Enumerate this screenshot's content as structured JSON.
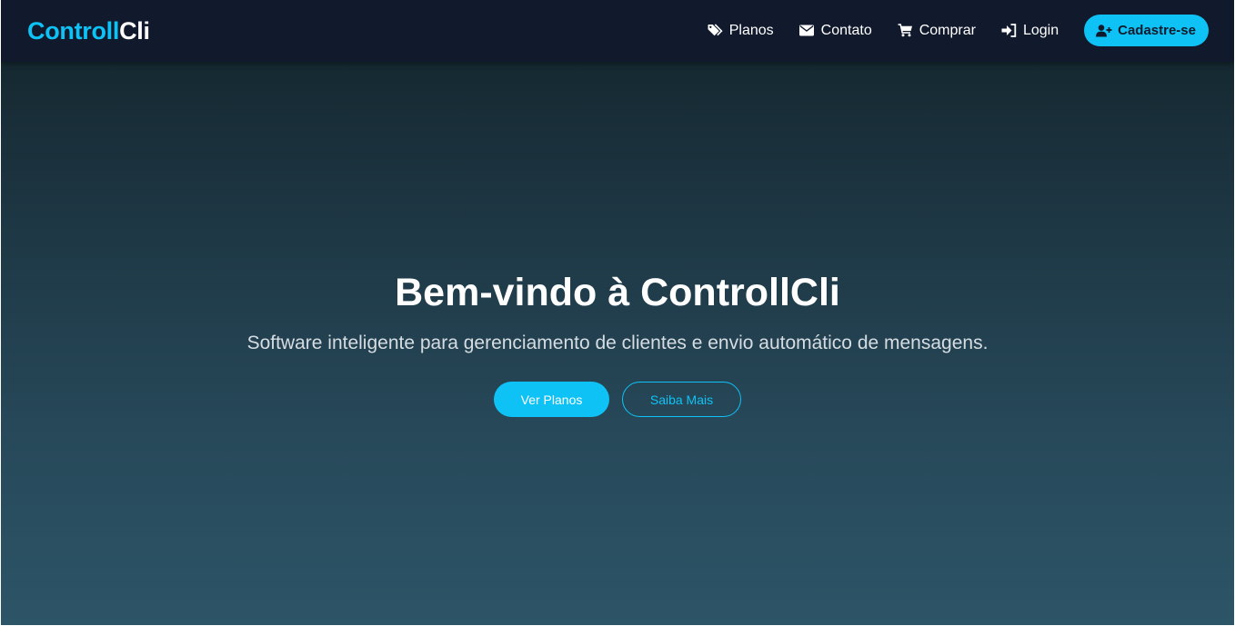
{
  "navbar": {
    "brand": {
      "part1": "Controll",
      "part2": "Cli"
    },
    "links": [
      {
        "label": "Planos",
        "icon": "tags-icon"
      },
      {
        "label": "Contato",
        "icon": "envelope-icon"
      },
      {
        "label": "Comprar",
        "icon": "cart-icon"
      },
      {
        "label": "Login",
        "icon": "sign-in-icon"
      }
    ],
    "cta": {
      "label": "Cadastre-se",
      "icon": "user-plus-icon"
    }
  },
  "hero": {
    "title": "Bem-vindo à ControllCli",
    "subtitle": "Software inteligente para gerenciamento de clientes e envio automático de mensagens.",
    "primary_button": "Ver Planos",
    "secondary_button": "Saiba Mais"
  },
  "colors": {
    "accent": "#0fc2f5",
    "navbar_bg": "#111a2c",
    "hero_gradient_top": "#12232a",
    "hero_gradient_bottom": "#2c5567"
  }
}
